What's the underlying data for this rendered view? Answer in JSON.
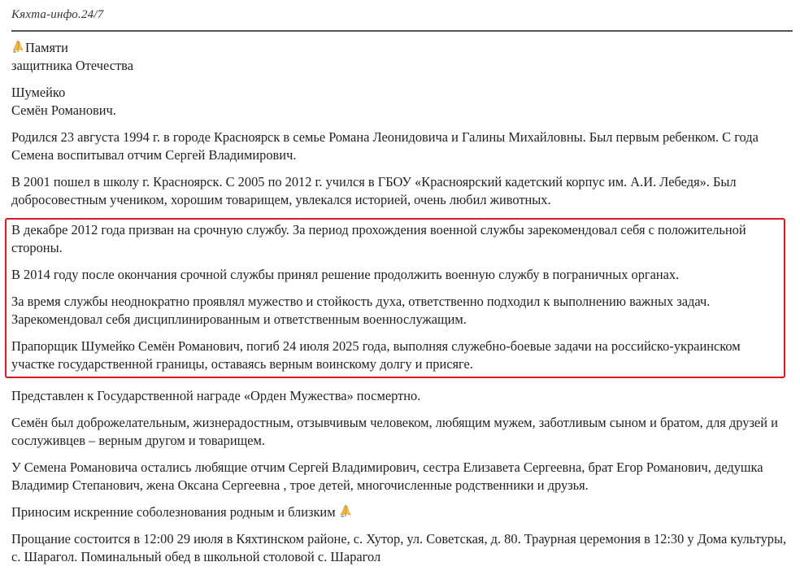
{
  "header": {
    "site_title": "Кяхта-инфо.24/7"
  },
  "icons": {
    "praying_hands": "praying-hands-icon",
    "color": "#f4b63f"
  },
  "colors": {
    "highlight_border": "#e0151f",
    "text": "#222222",
    "divider": "#555555"
  },
  "article": {
    "intro": {
      "line1": "Памяти",
      "line2": "защитника Отечества"
    },
    "name": {
      "line1": "Шумейко",
      "line2": "Семён Романович."
    },
    "p_birth": "Родился 23 августа 1994 г. в городе Красноярск в семье Романа Леонидовича и Галины Михайловны. Был первым ребенком. С года Семена воспитывал отчим Сергей Владимирович.",
    "p_school": "В 2001 пошел в школу г. Красноярск. С 2005 по 2012 г. учился в ГБОУ «Красноярский кадетский корпус им. А.И. Лебедя». Был добросовестным учеником, хорошим товарищем, увлекался историей, очень любил животных.",
    "highlighted": {
      "p1": "В декабре 2012 года призван на срочную службу. За период прохождения военной службы зарекомендовал себя с положительной стороны.",
      "p2": "В 2014 году после окончания срочной службы принял решение продолжить военную службу в пограничных органах.",
      "p3": "За время службы неоднократно проявлял мужество и стойкость духа, ответственно подходил к выполнению важных задач. Зарекомендовал себя дисциплинированным и ответственным военнослужащим.",
      "p4": "Прапорщик Шумейко Семён Романович, погиб 24 июля 2025 года, выполняя служебно-боевые задачи на российско-украинском участке государственной границы, оставаясь верным воинскому долгу и присяге."
    },
    "p_award": "Представлен к Государственной награде «Орден Мужества» посмертно.",
    "p_character": "Семён был доброжелательным, жизнерадостным, отзывчивым человеком, любящим мужем, заботливым сыном и братом, для друзей и сослуживцев – верным другом и товарищем.",
    "p_family": "У Семена Романовича остались любящие отчим Сергей Владимирович, сестра Елизавета Сергеевна, брат Егор Романович, дедушка Владимир Степанович, жена Оксана Сергеевна , трое детей, многочисленные родственники и друзья.",
    "p_condolences": "Приносим искренние соболезнования родным и близким ",
    "p_farewell": "Прощание состоится в 12:00 29 июля в Кяхтинском районе, с. Хутор, ул. Советская, д. 80. Траурная церемония в 12:30 у Дома культуры, с. Шарагол. Поминальный обед в школьной столовой с. Шарагол"
  }
}
